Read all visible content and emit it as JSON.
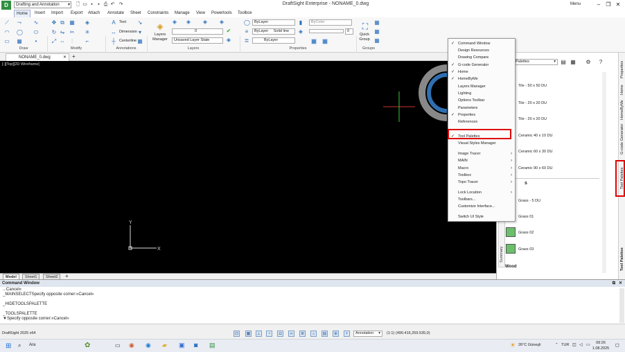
{
  "app": {
    "workspace": "Drafting and Annotation",
    "title": "DraftSight Enterprise - NONAME_0.dwg",
    "menu_label": "Menu"
  },
  "menu": [
    "Home",
    "Insert",
    "Import",
    "Export",
    "Attach",
    "Annotate",
    "Sheet",
    "Constraints",
    "Manage",
    "View",
    "Powertools",
    "Toolbox"
  ],
  "ribbon": {
    "groups": [
      "Draw",
      "Modify",
      "Annotations",
      "Layers",
      "Properties",
      "Groups"
    ],
    "text_label": "Text",
    "dimension_label": "Dimension",
    "centerline_label": "Centerline",
    "layers_manager": "Layers Manager",
    "layer_state": "Unsaved Layer State",
    "layer_current": "0",
    "color": "ByLayer",
    "linetype": "ByLayer",
    "linestyle": "Solid line",
    "lineweight": "ByLayer",
    "bycolor": "ByColor",
    "transparency": "0",
    "quick_group": "Quick Group"
  },
  "document": {
    "tab": "NONAME_0.dwg",
    "view_label": "[-][Top][2D Wireframe]"
  },
  "sheets": [
    "Model",
    "Sheet1",
    "Sheet2"
  ],
  "command": {
    "title": "Command Window",
    "lines": [
      "..:Cancel»",
      "_MAINSELECTSpecify opposite corner:«Cancel»",
      "",
      "_HIDETOOLSPALETTE",
      "",
      "_TOOLSPALETTE",
      "▼Specify opposite corner:«Cancel»"
    ]
  },
  "status": {
    "app_version": "DraftSight 2025 x64",
    "annotation": "Annotation",
    "scale": "(1:1)",
    "coords": "(490.416,259.535,0)"
  },
  "taskbar": {
    "search": "Ara",
    "weather": "26°C  Güneşli",
    "lang": "TUR",
    "time": "09:26",
    "date": "1.08.2025"
  },
  "context_menu": [
    {
      "label": "Command Window",
      "checked": true,
      "sub": false
    },
    {
      "label": "Design Resources",
      "checked": false,
      "sub": false
    },
    {
      "label": "Drawing Compare",
      "checked": false,
      "sub": false
    },
    {
      "label": "G-code Generator",
      "checked": true,
      "sub": false
    },
    {
      "label": "Home",
      "checked": true,
      "sub": false
    },
    {
      "label": "HomeByMe",
      "checked": true,
      "sub": false
    },
    {
      "label": "Layers Manager",
      "checked": false,
      "sub": false
    },
    {
      "label": "Lighting",
      "checked": false,
      "sub": false
    },
    {
      "label": "Options Toolbar",
      "checked": false,
      "sub": false
    },
    {
      "label": "Parameters",
      "checked": false,
      "sub": false
    },
    {
      "label": "Properties",
      "checked": true,
      "sub": false
    },
    {
      "label": "References",
      "checked": false,
      "sub": false
    },
    {
      "label": "Tool Palettes",
      "checked": true,
      "sub": false
    },
    {
      "label": "Visual Styles Manager",
      "checked": false,
      "sub": false
    },
    {
      "label": "Image Tracer",
      "checked": false,
      "sub": true
    },
    {
      "label": "MAIN",
      "checked": false,
      "sub": true
    },
    {
      "label": "Macro",
      "checked": false,
      "sub": true
    },
    {
      "label": "Toolbox",
      "checked": false,
      "sub": true
    },
    {
      "label": "Topo Tracer",
      "checked": false,
      "sub": true
    },
    {
      "label": "Lock Location",
      "checked": false,
      "sub": true
    },
    {
      "label": "Toolbars...",
      "checked": false,
      "sub": false
    },
    {
      "label": "Customize Interface...",
      "checked": false,
      "sub": false
    },
    {
      "label": "Switch UI Style",
      "checked": false,
      "sub": false
    }
  ],
  "palette": {
    "dropdown": "Palettes",
    "items": [
      "Tile - 50 x 50 DU",
      "Tile - 20 x 20 DU",
      "Tile - 20 x 20 DU",
      "Ceramic 40 x 10 DU",
      "Ceramic 60 x 30 DU",
      "Ceramic 90 x 60 DU",
      "Grass - 5 DU",
      "Grass 01",
      "Grass 02",
      "Grass 03"
    ],
    "section_s": "s",
    "section_wood": "Wood",
    "tabs": [
      "Summary"
    ],
    "right_tabs": [
      "Properties",
      "Home",
      "HomeByMe",
      "G-code Generator",
      "Tool Palettes"
    ],
    "tool_palettes_title": "Tool Palettes"
  }
}
